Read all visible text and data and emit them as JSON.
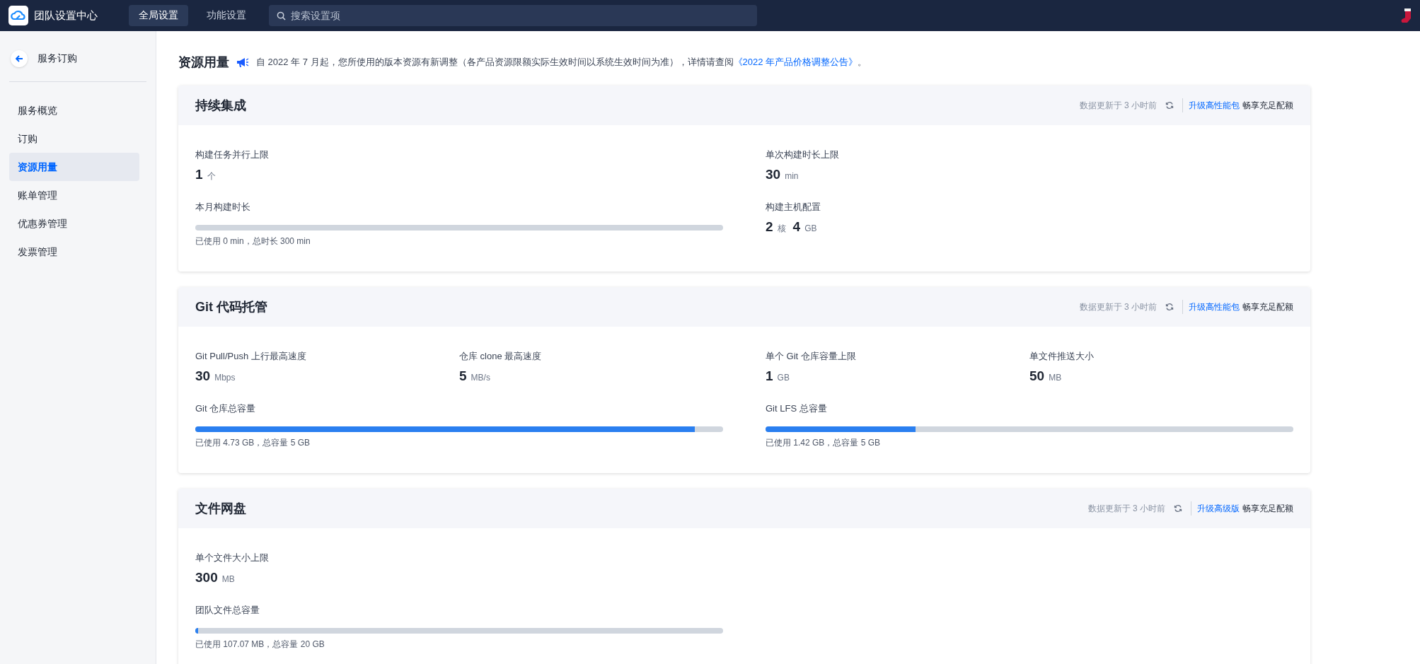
{
  "topbar": {
    "title": "团队设置中心",
    "tabs": [
      {
        "label": "全局设置",
        "selected": true
      },
      {
        "label": "功能设置",
        "selected": false
      }
    ],
    "search": {
      "placeholder": "搜索设置项"
    }
  },
  "sidebar": {
    "back_label": "服务订购",
    "items": [
      {
        "label": "服务概览",
        "selected": false
      },
      {
        "label": "订购",
        "selected": false
      },
      {
        "label": "资源用量",
        "selected": true
      },
      {
        "label": "账单管理",
        "selected": false
      },
      {
        "label": "优惠券管理",
        "selected": false
      },
      {
        "label": "发票管理",
        "selected": false
      }
    ]
  },
  "page": {
    "title": "资源用量",
    "notice": {
      "text": "自 2022 年 7 月起，您所使用的版本资源有新调整（各产品资源限额实际生效时间以系统生效时间为准），详情请查阅",
      "link": "《2022 年产品价格调整公告》",
      "suffix": "。"
    }
  },
  "cards": [
    {
      "title": "持续集成",
      "updated": "数据更新于 3 小时前",
      "upgrade_link": "升级高性能包",
      "upgrade_text": "畅享充足配额",
      "rows": [
        [
          [
            {
              "kind": "stat",
              "label": "构建任务并行上限",
              "parts": [
                {
                  "value": "1",
                  "unit": "个"
                }
              ]
            }
          ],
          [
            {
              "kind": "stat",
              "label": "单次构建时长上限",
              "parts": [
                {
                  "value": "30",
                  "unit": "min"
                }
              ]
            }
          ]
        ],
        [
          [
            {
              "kind": "usage",
              "label": "本月构建时长",
              "level": 0,
              "caption": "已使用 0 min，总时长 300 min"
            }
          ],
          [
            {
              "kind": "stat",
              "label": "构建主机配置",
              "parts": [
                {
                  "value": "2",
                  "unit": "核"
                },
                {
                  "value": "4",
                  "unit": "GB"
                }
              ]
            }
          ]
        ]
      ]
    },
    {
      "title": "Git 代码托管",
      "updated": "数据更新于 3 小时前",
      "upgrade_link": "升级高性能包",
      "upgrade_text": "畅享充足配额",
      "rows": [
        [
          [
            {
              "kind": "stat",
              "label": "Git Pull/Push 上行最高速度",
              "parts": [
                {
                  "value": "30",
                  "unit": "Mbps"
                }
              ]
            },
            {
              "kind": "stat",
              "label": "仓库 clone 最高速度",
              "parts": [
                {
                  "value": "5",
                  "unit": "MB/s"
                }
              ]
            }
          ],
          [
            {
              "kind": "stat",
              "label": "单个 Git 仓库容量上限",
              "parts": [
                {
                  "value": "1",
                  "unit": "GB"
                }
              ]
            },
            {
              "kind": "stat",
              "label": "单文件推送大小",
              "parts": [
                {
                  "value": "50",
                  "unit": "MB"
                }
              ]
            }
          ]
        ],
        [
          [
            {
              "kind": "usage",
              "label": "Git 仓库总容量",
              "level": 0.946,
              "caption": "已使用 4.73 GB，总容量 5 GB"
            }
          ],
          [
            {
              "kind": "usage",
              "label": "Git LFS 总容量",
              "level": 0.284,
              "caption": "已使用 1.42 GB，总容量 5 GB"
            }
          ]
        ]
      ]
    },
    {
      "title": "文件网盘",
      "updated": "数据更新于 3 小时前",
      "upgrade_link": "升级高级版",
      "upgrade_text": "畅享充足配额",
      "rows": [
        [
          [
            {
              "kind": "stat",
              "label": "单个文件大小上限",
              "parts": [
                {
                  "value": "300",
                  "unit": "MB"
                }
              ]
            }
          ]
        ],
        [
          [
            {
              "kind": "usage",
              "label": "团队文件总容量",
              "level": 0.0052,
              "caption": "已使用 107.07 MB，总容量 20 GB"
            }
          ]
        ]
      ]
    }
  ]
}
